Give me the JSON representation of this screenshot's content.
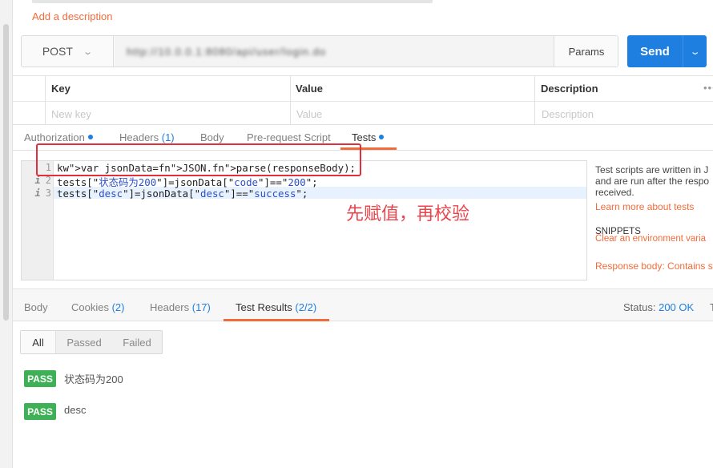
{
  "request": {
    "add_description": "Add a description",
    "method": "POST",
    "url": "http://10.0.0.1:8080/api/user/login.do",
    "params_label": "Params",
    "send_label": "Send"
  },
  "headers_table": {
    "columns": [
      "Key",
      "Value",
      "Description"
    ],
    "placeholders": [
      "New key",
      "Value",
      "Description"
    ]
  },
  "request_tabs": [
    {
      "label": "Authorization",
      "count": "",
      "dot": true
    },
    {
      "label": "Headers ",
      "count": "(1)",
      "dot": false
    },
    {
      "label": "Body",
      "count": "",
      "dot": false
    },
    {
      "label": "Pre-request Script",
      "count": "",
      "dot": false
    },
    {
      "label": "Tests",
      "count": "",
      "dot": true
    }
  ],
  "editor": {
    "line_numbers": [
      "1",
      "2",
      "3"
    ],
    "lines": [
      "var jsonData=JSON.parse(responseBody);",
      "tests[\"状态码为200\"]=jsonData[\"code\"]==\"200\";",
      "tests[\"desc\"]=jsonData[\"desc\"]==\"success\";"
    ]
  },
  "annotation": "先赋值，再校验",
  "help": {
    "line1": "Test scripts are written in J",
    "line2": "and are run after the respo",
    "line3": "received.",
    "learn_more": "Learn more about tests",
    "snippets": "SNIPPETS",
    "snippet1": "Clear an environment varia",
    "snippet2": "Response body: Contains s"
  },
  "response_tabs": [
    {
      "label": "Body",
      "count": ""
    },
    {
      "label": "Cookies ",
      "count": "(2)"
    },
    {
      "label": "Headers ",
      "count": "(17)"
    },
    {
      "label": "Test Results ",
      "count": "(2/2)"
    }
  ],
  "status": {
    "label": "Status:",
    "value": "200 OK",
    "trailing": "T"
  },
  "filters": [
    "All",
    "Passed",
    "Failed"
  ],
  "results": [
    {
      "badge": "PASS",
      "name": "状态码为200"
    },
    {
      "badge": "PASS",
      "name": "desc"
    }
  ],
  "colors": {
    "accent": "#f26b3a",
    "primary": "#1f7fe0",
    "pass": "#3eb157",
    "annotation": "#e8454d"
  }
}
